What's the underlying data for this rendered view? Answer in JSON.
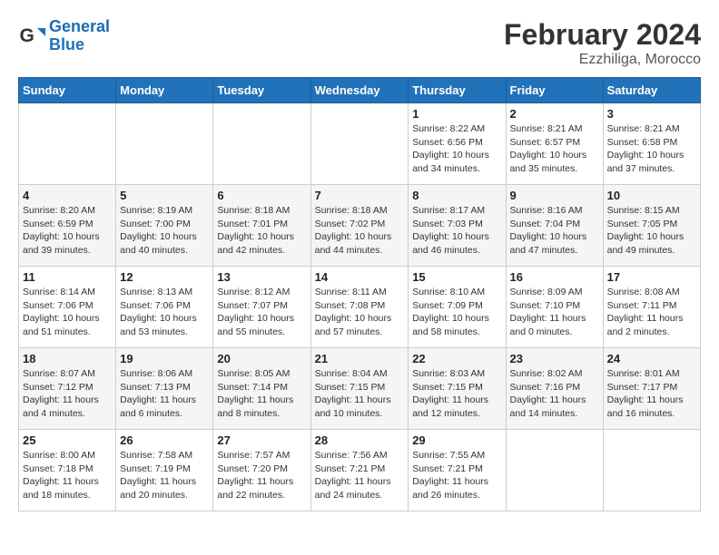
{
  "header": {
    "logo_line1": "General",
    "logo_line2": "Blue",
    "month": "February 2024",
    "location": "Ezzhiliga, Morocco"
  },
  "weekdays": [
    "Sunday",
    "Monday",
    "Tuesday",
    "Wednesday",
    "Thursday",
    "Friday",
    "Saturday"
  ],
  "weeks": [
    [
      {
        "day": "",
        "info": ""
      },
      {
        "day": "",
        "info": ""
      },
      {
        "day": "",
        "info": ""
      },
      {
        "day": "",
        "info": ""
      },
      {
        "day": "1",
        "info": "Sunrise: 8:22 AM\nSunset: 6:56 PM\nDaylight: 10 hours\nand 34 minutes."
      },
      {
        "day": "2",
        "info": "Sunrise: 8:21 AM\nSunset: 6:57 PM\nDaylight: 10 hours\nand 35 minutes."
      },
      {
        "day": "3",
        "info": "Sunrise: 8:21 AM\nSunset: 6:58 PM\nDaylight: 10 hours\nand 37 minutes."
      }
    ],
    [
      {
        "day": "4",
        "info": "Sunrise: 8:20 AM\nSunset: 6:59 PM\nDaylight: 10 hours\nand 39 minutes."
      },
      {
        "day": "5",
        "info": "Sunrise: 8:19 AM\nSunset: 7:00 PM\nDaylight: 10 hours\nand 40 minutes."
      },
      {
        "day": "6",
        "info": "Sunrise: 8:18 AM\nSunset: 7:01 PM\nDaylight: 10 hours\nand 42 minutes."
      },
      {
        "day": "7",
        "info": "Sunrise: 8:18 AM\nSunset: 7:02 PM\nDaylight: 10 hours\nand 44 minutes."
      },
      {
        "day": "8",
        "info": "Sunrise: 8:17 AM\nSunset: 7:03 PM\nDaylight: 10 hours\nand 46 minutes."
      },
      {
        "day": "9",
        "info": "Sunrise: 8:16 AM\nSunset: 7:04 PM\nDaylight: 10 hours\nand 47 minutes."
      },
      {
        "day": "10",
        "info": "Sunrise: 8:15 AM\nSunset: 7:05 PM\nDaylight: 10 hours\nand 49 minutes."
      }
    ],
    [
      {
        "day": "11",
        "info": "Sunrise: 8:14 AM\nSunset: 7:06 PM\nDaylight: 10 hours\nand 51 minutes."
      },
      {
        "day": "12",
        "info": "Sunrise: 8:13 AM\nSunset: 7:06 PM\nDaylight: 10 hours\nand 53 minutes."
      },
      {
        "day": "13",
        "info": "Sunrise: 8:12 AM\nSunset: 7:07 PM\nDaylight: 10 hours\nand 55 minutes."
      },
      {
        "day": "14",
        "info": "Sunrise: 8:11 AM\nSunset: 7:08 PM\nDaylight: 10 hours\nand 57 minutes."
      },
      {
        "day": "15",
        "info": "Sunrise: 8:10 AM\nSunset: 7:09 PM\nDaylight: 10 hours\nand 58 minutes."
      },
      {
        "day": "16",
        "info": "Sunrise: 8:09 AM\nSunset: 7:10 PM\nDaylight: 11 hours\nand 0 minutes."
      },
      {
        "day": "17",
        "info": "Sunrise: 8:08 AM\nSunset: 7:11 PM\nDaylight: 11 hours\nand 2 minutes."
      }
    ],
    [
      {
        "day": "18",
        "info": "Sunrise: 8:07 AM\nSunset: 7:12 PM\nDaylight: 11 hours\nand 4 minutes."
      },
      {
        "day": "19",
        "info": "Sunrise: 8:06 AM\nSunset: 7:13 PM\nDaylight: 11 hours\nand 6 minutes."
      },
      {
        "day": "20",
        "info": "Sunrise: 8:05 AM\nSunset: 7:14 PM\nDaylight: 11 hours\nand 8 minutes."
      },
      {
        "day": "21",
        "info": "Sunrise: 8:04 AM\nSunset: 7:15 PM\nDaylight: 11 hours\nand 10 minutes."
      },
      {
        "day": "22",
        "info": "Sunrise: 8:03 AM\nSunset: 7:15 PM\nDaylight: 11 hours\nand 12 minutes."
      },
      {
        "day": "23",
        "info": "Sunrise: 8:02 AM\nSunset: 7:16 PM\nDaylight: 11 hours\nand 14 minutes."
      },
      {
        "day": "24",
        "info": "Sunrise: 8:01 AM\nSunset: 7:17 PM\nDaylight: 11 hours\nand 16 minutes."
      }
    ],
    [
      {
        "day": "25",
        "info": "Sunrise: 8:00 AM\nSunset: 7:18 PM\nDaylight: 11 hours\nand 18 minutes."
      },
      {
        "day": "26",
        "info": "Sunrise: 7:58 AM\nSunset: 7:19 PM\nDaylight: 11 hours\nand 20 minutes."
      },
      {
        "day": "27",
        "info": "Sunrise: 7:57 AM\nSunset: 7:20 PM\nDaylight: 11 hours\nand 22 minutes."
      },
      {
        "day": "28",
        "info": "Sunrise: 7:56 AM\nSunset: 7:21 PM\nDaylight: 11 hours\nand 24 minutes."
      },
      {
        "day": "29",
        "info": "Sunrise: 7:55 AM\nSunset: 7:21 PM\nDaylight: 11 hours\nand 26 minutes."
      },
      {
        "day": "",
        "info": ""
      },
      {
        "day": "",
        "info": ""
      }
    ]
  ]
}
